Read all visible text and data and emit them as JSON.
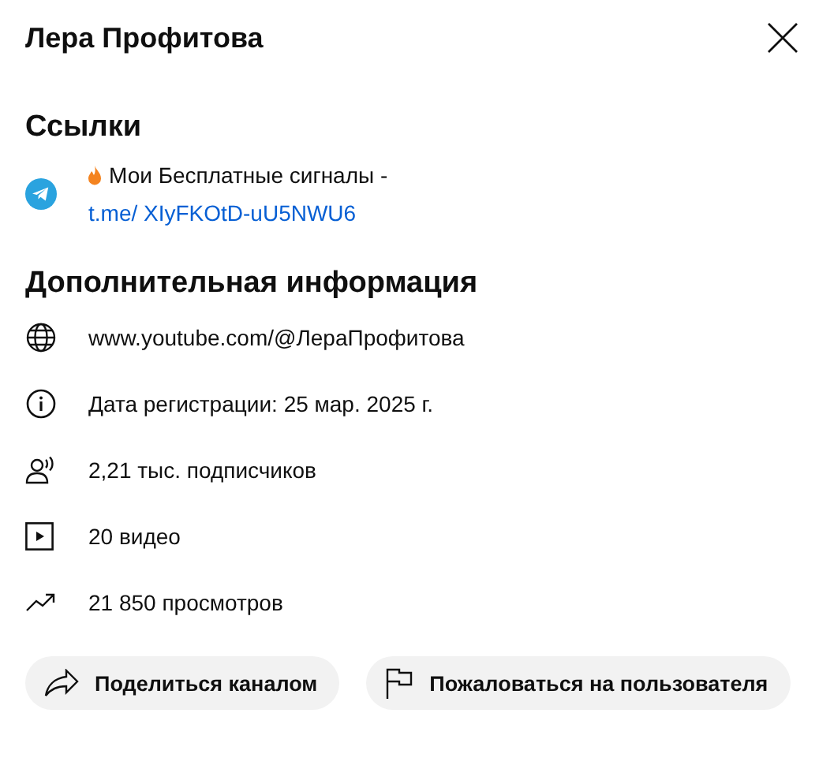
{
  "title": "Лера Профитова",
  "links_section": {
    "heading": "Ссылки",
    "links": [
      {
        "kind": "telegram",
        "title": "Мои Бесплатные сигналы -",
        "url": "t.me/ XIyFKOtD-uU5NWU6"
      }
    ]
  },
  "info_section": {
    "heading": "Дополнительная информация",
    "rows": [
      {
        "kind": "globe",
        "text": "www.youtube.com/@ЛераПрофитова"
      },
      {
        "kind": "info",
        "text": "Дата регистрации: 25 мар. 2025 г."
      },
      {
        "kind": "subscribers",
        "text": "2,21 тыс. подписчиков"
      },
      {
        "kind": "video",
        "text": "20 видео"
      },
      {
        "kind": "views",
        "text": "21 850 просмотров"
      }
    ]
  },
  "buttons": [
    {
      "kind": "share",
      "label": "Поделиться каналом"
    },
    {
      "kind": "flag",
      "label": "Пожаловаться на пользователя"
    }
  ]
}
